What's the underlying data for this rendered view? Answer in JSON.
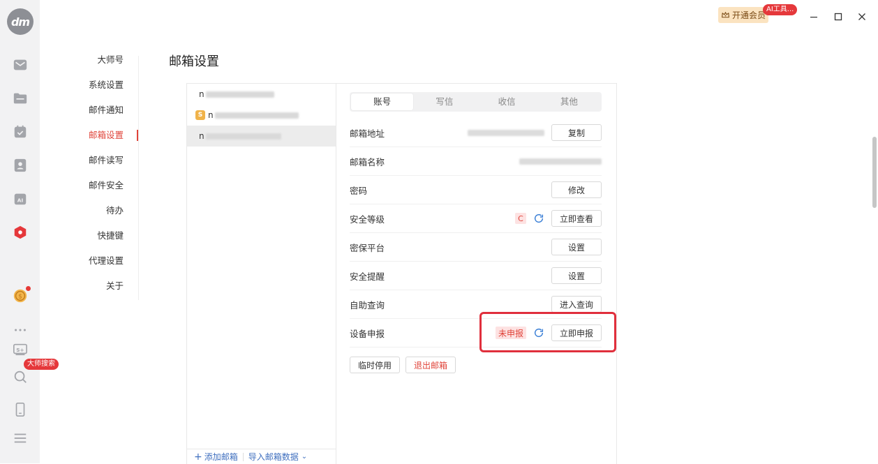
{
  "app": {
    "logo_text": "dm",
    "vip_label": "开通会员",
    "ai_badge": "AI工具...",
    "search_badge": "大师搜索"
  },
  "rail_icons": [
    "mail-icon",
    "folder-icon",
    "calendar-icon",
    "contacts-icon",
    "ai-icon",
    "hexagon-app-icon",
    "coin-icon",
    "more-icon",
    "s-plus-icon",
    "search-icon",
    "phone-icon",
    "menu-icon"
  ],
  "settings_nav": {
    "items": [
      {
        "label": "大师号",
        "active": false
      },
      {
        "label": "系统设置",
        "active": false
      },
      {
        "label": "邮件通知",
        "active": false
      },
      {
        "label": "邮箱设置",
        "active": true
      },
      {
        "label": "邮件读写",
        "active": false
      },
      {
        "label": "邮件安全",
        "active": false
      },
      {
        "label": "待办",
        "active": false
      },
      {
        "label": "快捷键",
        "active": false
      },
      {
        "label": "代理设置",
        "active": false
      },
      {
        "label": "关于",
        "active": false
      }
    ]
  },
  "page_title": "邮箱设置",
  "accounts": {
    "items": [
      {
        "prefix": "n",
        "tag": ""
      },
      {
        "prefix": "n",
        "tag": "S"
      },
      {
        "prefix": "n",
        "tag": ""
      }
    ],
    "add_label": "添加邮箱",
    "import_label": "导入邮箱数据"
  },
  "tabs": [
    "账号",
    "写信",
    "收信",
    "其他"
  ],
  "rows": {
    "email_address": {
      "label": "邮箱地址",
      "button": "复制"
    },
    "email_name": {
      "label": "邮箱名称"
    },
    "password": {
      "label": "密码",
      "button": "修改"
    },
    "security_level": {
      "label": "安全等级",
      "level": "C",
      "button": "立即查看"
    },
    "security_platform": {
      "label": "密保平台",
      "button": "设置"
    },
    "security_reminder": {
      "label": "安全提醒",
      "button": "设置"
    },
    "self_query": {
      "label": "自助查询",
      "button": "进入查询"
    },
    "device_report": {
      "label": "设备申报",
      "status": "未申报",
      "button": "立即申报"
    }
  },
  "actions": {
    "suspend": "临时停用",
    "logout": "退出邮箱"
  },
  "colors": {
    "accent_red": "#e0443a",
    "highlight_border": "#e02f3c",
    "link_blue": "#3f6fbf",
    "vip_bg": "#fbe3c0"
  }
}
